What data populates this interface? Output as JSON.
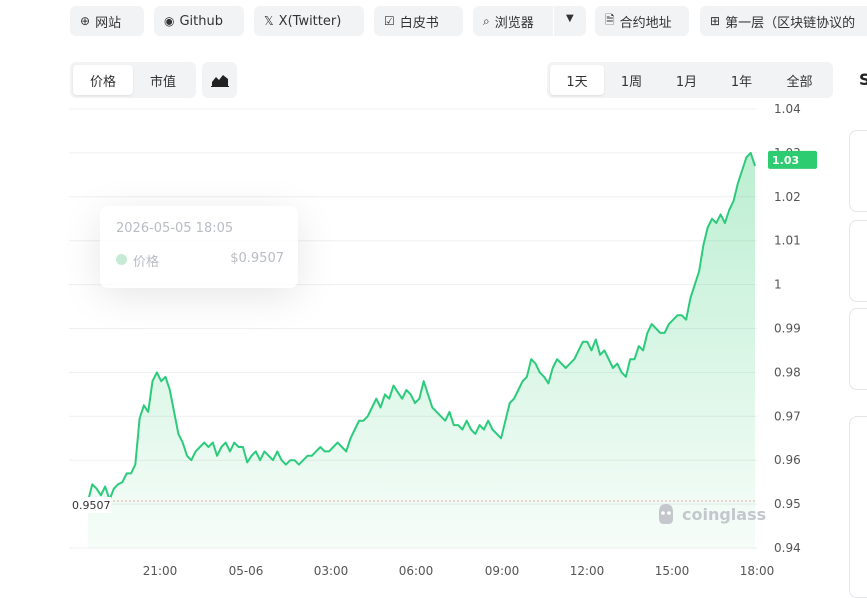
{
  "top_links": [
    {
      "icon": "globe-icon",
      "label": "网站"
    },
    {
      "icon": "github-icon",
      "label": "Github"
    },
    {
      "icon": "x-icon",
      "label": "X(Twitter)"
    },
    {
      "icon": "document-icon",
      "label": "白皮书"
    },
    {
      "icon": "search-icon",
      "label": "浏览器"
    },
    {
      "icon": "file-icon",
      "label": "合约地址"
    },
    {
      "icon": "grid-icon",
      "label": "第一层（区块链协议的"
    }
  ],
  "metric_tabs": [
    "价格",
    "市值"
  ],
  "range_tabs": [
    "1天",
    "1周",
    "1月",
    "1年",
    "全部"
  ],
  "tooltip": {
    "date": "2026-05-05 18:05",
    "label": "价格",
    "value": "$0.9507"
  },
  "watermark": "coinglass",
  "right_edge_letter": "S",
  "colors": {
    "line": "#2ccb7c",
    "accent": "#2ecc71",
    "baseline": "#e9a7a7"
  },
  "chart_data": {
    "type": "area",
    "x_ticks": [
      "21:00",
      "05-06",
      "03:00",
      "06:00",
      "09:00",
      "12:00",
      "15:00",
      "18:00"
    ],
    "y_ticks": [
      "1.04",
      "1.03",
      "1.02",
      "1.01",
      "1",
      "0.99",
      "0.98",
      "0.97",
      "0.96",
      "0.95",
      "0.94"
    ],
    "ylim": [
      0.94,
      1.04
    ],
    "current_value": "1.03",
    "start_value": "0.9507",
    "series": [
      {
        "values": [
          0.9507,
          0.9545,
          0.9535,
          0.952,
          0.954,
          0.951,
          0.9535,
          0.9545,
          0.955,
          0.957,
          0.957,
          0.959,
          0.9695,
          0.9725,
          0.971,
          0.978,
          0.98,
          0.978,
          0.979,
          0.976,
          0.971,
          0.966,
          0.964,
          0.961,
          0.96,
          0.962,
          0.963,
          0.964,
          0.963,
          0.964,
          0.961,
          0.963,
          0.964,
          0.962,
          0.964,
          0.963,
          0.963,
          0.9595,
          0.961,
          0.962,
          0.96,
          0.962,
          0.961,
          0.96,
          0.962,
          0.96,
          0.959,
          0.96,
          0.96,
          0.959,
          0.96,
          0.961,
          0.961,
          0.962,
          0.963,
          0.962,
          0.962,
          0.963,
          0.964,
          0.963,
          0.962,
          0.965,
          0.967,
          0.969,
          0.969,
          0.97,
          0.972,
          0.974,
          0.972,
          0.975,
          0.974,
          0.977,
          0.9755,
          0.974,
          0.976,
          0.975,
          0.973,
          0.974,
          0.978,
          0.975,
          0.972,
          0.971,
          0.97,
          0.969,
          0.971,
          0.968,
          0.968,
          0.967,
          0.969,
          0.967,
          0.966,
          0.968,
          0.967,
          0.969,
          0.967,
          0.966,
          0.965,
          0.969,
          0.973,
          0.974,
          0.976,
          0.978,
          0.979,
          0.983,
          0.982,
          0.98,
          0.979,
          0.9775,
          0.981,
          0.983,
          0.982,
          0.981,
          0.982,
          0.983,
          0.985,
          0.987,
          0.987,
          0.985,
          0.9875,
          0.984,
          0.985,
          0.983,
          0.981,
          0.982,
          0.98,
          0.979,
          0.983,
          0.983,
          0.986,
          0.985,
          0.989,
          0.991,
          0.99,
          0.989,
          0.989,
          0.991,
          0.992,
          0.993,
          0.993,
          0.992,
          0.997,
          1.0,
          1.003,
          1.009,
          1.013,
          1.015,
          1.014,
          1.016,
          1.014,
          1.017,
          1.019,
          1.023,
          1.026,
          1.029,
          1.03,
          1.027
        ]
      }
    ]
  }
}
